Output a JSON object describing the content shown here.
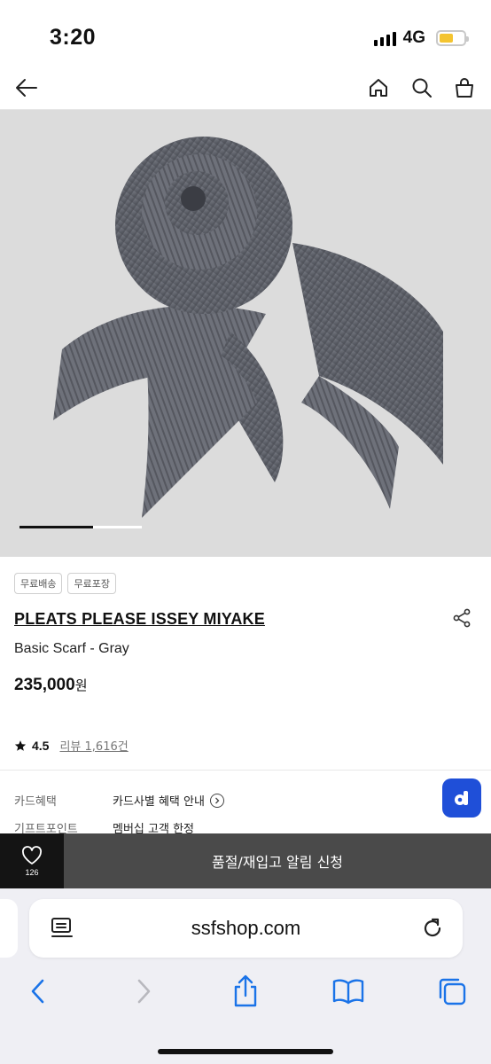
{
  "status_bar": {
    "time": "3:20",
    "network": "4G",
    "battery_color": "#f4c430"
  },
  "header": {
    "icons": [
      "back-arrow-icon",
      "home-icon",
      "search-icon",
      "shopping-bag-icon"
    ]
  },
  "gallery": {
    "image_description_icon": "gray-pleated-scarf-image",
    "slide_progress": 0.6
  },
  "product": {
    "tags": [
      "무료배송",
      "무료포장"
    ],
    "brand": "PLEATS PLEASE ISSEY MIYAKE",
    "name": "Basic Scarf - Gray",
    "price": "235,000",
    "currency": "원",
    "rating": "4.5",
    "reviews": "리뷰 1,616건"
  },
  "benefits": [
    {
      "label": "카드혜택",
      "value": "카드사별 혜택 안내"
    },
    {
      "label": "기프트포인트",
      "value": "멤버십 고객 한정"
    }
  ],
  "action_bar": {
    "wish_count": "126",
    "restock_label": "품절/재입고 알림 신청"
  },
  "browser": {
    "url": "ssfshop.com",
    "accent": "#1a73e8"
  }
}
